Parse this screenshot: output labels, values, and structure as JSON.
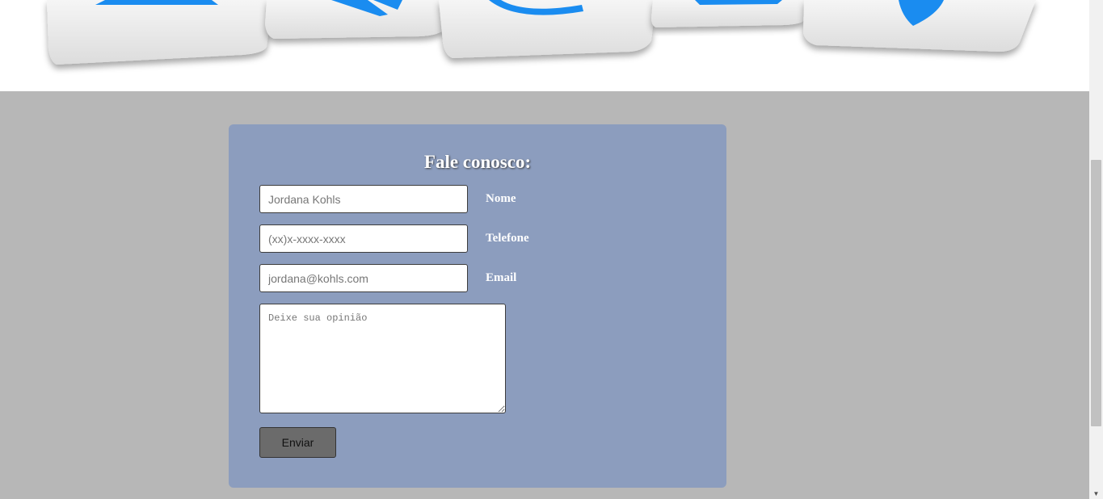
{
  "hero": {
    "image_icons": [
      "email-icon",
      "phone-icon",
      "at-sign-icon",
      "chat-icon",
      "location-pin-icon"
    ],
    "accent_color": "#1a8cf0"
  },
  "contact_form": {
    "title": "Fale conosco:",
    "name_field": {
      "value": "",
      "placeholder": "Jordana Kohls",
      "label": "Nome"
    },
    "phone_field": {
      "value": "",
      "placeholder": "(xx)x-xxxx-xxxx",
      "label": "Telefone"
    },
    "email_field": {
      "value": "",
      "placeholder": "jordana@kohls.com",
      "label": "Email"
    },
    "opinion_field": {
      "value": "",
      "placeholder": "Deixe sua opinião"
    },
    "submit_label": "Enviar",
    "card_color": "#8c9dbe"
  }
}
